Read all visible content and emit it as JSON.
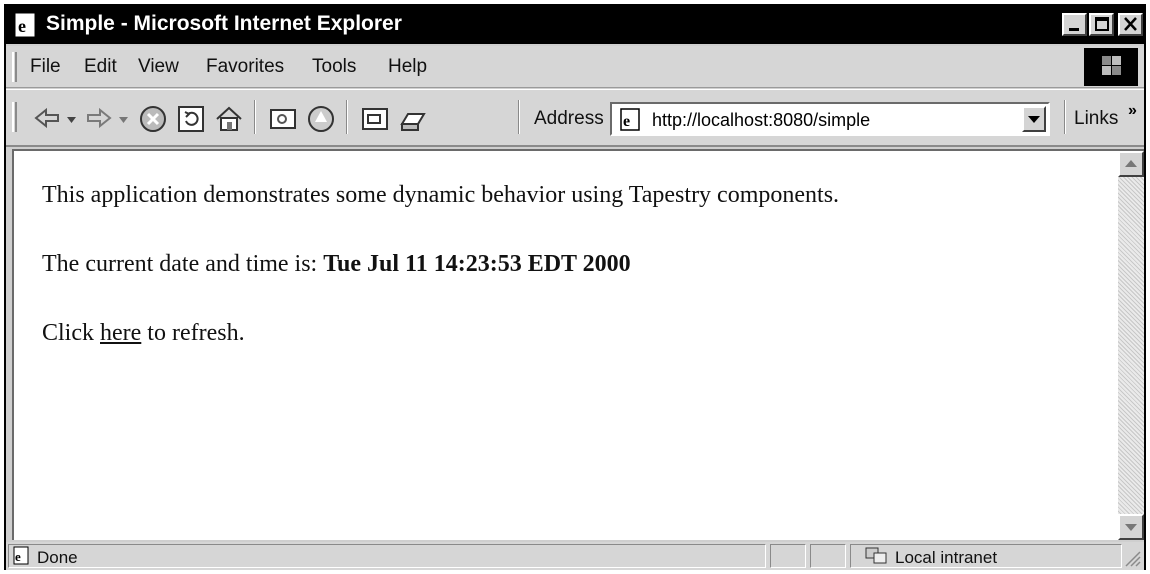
{
  "window": {
    "title": "Simple - Microsoft Internet Explorer"
  },
  "menu": {
    "items": [
      "File",
      "Edit",
      "View",
      "Favorites",
      "Tools",
      "Help"
    ]
  },
  "toolbar": {
    "icons": [
      "back-icon",
      "forward-icon",
      "stop-icon",
      "refresh-icon",
      "home-icon",
      "search-icon",
      "favorites-icon",
      "history-icon",
      "mail-icon",
      "print-icon"
    ],
    "address_label": "Address",
    "address_value": "http://localhost:8080/simple",
    "links_label": "Links",
    "links_chevron": "»"
  },
  "page": {
    "intro": "This application demonstrates some dynamic behavior using Tapestry components.",
    "datetime_prefix": "The current date and time is: ",
    "datetime_value": "Tue Jul 11 14:23:53 EDT 2000",
    "refresh_prefix": "Click ",
    "refresh_link": "here",
    "refresh_suffix": " to refresh."
  },
  "status": {
    "text": "Done",
    "zone": "Local intranet"
  }
}
